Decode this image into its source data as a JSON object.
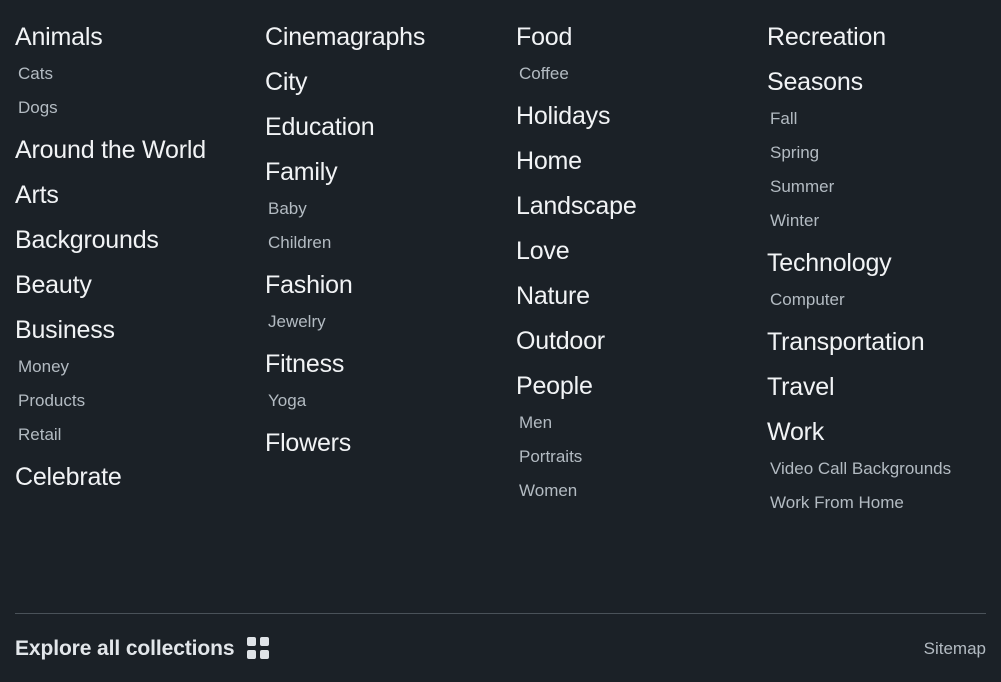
{
  "theme": {
    "background": "#1b2127",
    "heading_color": "#f1f3f5",
    "subitem_color": "#b3bbc2",
    "divider_color": "#4a5259",
    "footer_label_color": "#e2e6ea"
  },
  "columns": [
    {
      "groups": [
        {
          "title": "Animals",
          "items": [
            "Cats",
            "Dogs"
          ]
        },
        {
          "title": "Around the World",
          "items": []
        },
        {
          "title": "Arts",
          "items": []
        },
        {
          "title": "Backgrounds",
          "items": []
        },
        {
          "title": "Beauty",
          "items": []
        },
        {
          "title": "Business",
          "items": [
            "Money",
            "Products",
            "Retail"
          ]
        },
        {
          "title": "Celebrate",
          "items": []
        }
      ]
    },
    {
      "groups": [
        {
          "title": "Cinemagraphs",
          "items": []
        },
        {
          "title": "City",
          "items": []
        },
        {
          "title": "Education",
          "items": []
        },
        {
          "title": "Family",
          "items": [
            "Baby",
            "Children"
          ]
        },
        {
          "title": "Fashion",
          "items": [
            "Jewelry"
          ]
        },
        {
          "title": "Fitness",
          "items": [
            "Yoga"
          ]
        },
        {
          "title": "Flowers",
          "items": []
        }
      ]
    },
    {
      "groups": [
        {
          "title": "Food",
          "items": [
            "Coffee"
          ]
        },
        {
          "title": "Holidays",
          "items": []
        },
        {
          "title": "Home",
          "items": []
        },
        {
          "title": "Landscape",
          "items": []
        },
        {
          "title": "Love",
          "items": []
        },
        {
          "title": "Nature",
          "items": []
        },
        {
          "title": "Outdoor",
          "items": []
        },
        {
          "title": "People",
          "items": [
            "Men",
            "Portraits",
            "Women"
          ]
        }
      ]
    },
    {
      "groups": [
        {
          "title": "Recreation",
          "items": []
        },
        {
          "title": "Seasons",
          "items": [
            "Fall",
            "Spring",
            "Summer",
            "Winter"
          ]
        },
        {
          "title": "Technology",
          "items": [
            "Computer"
          ]
        },
        {
          "title": "Transportation",
          "items": []
        },
        {
          "title": "Travel",
          "items": []
        },
        {
          "title": "Work",
          "items": [
            "Video Call Backgrounds",
            "Work From Home"
          ]
        }
      ]
    }
  ],
  "footer": {
    "explore_label": "Explore all collections",
    "grid_icon": "grid-icon",
    "sitemap_label": "Sitemap"
  }
}
